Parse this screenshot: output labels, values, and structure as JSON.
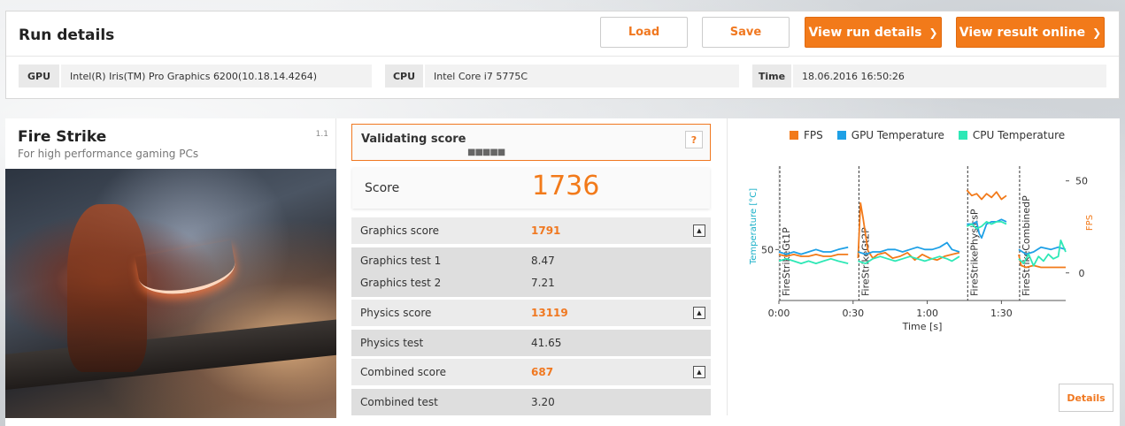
{
  "run": {
    "title": "Run details",
    "buttons": {
      "load": "Load",
      "save": "Save",
      "view_run_details": "View run details",
      "view_result_online": "View result online"
    },
    "info": {
      "gpu_label": "GPU",
      "gpu_value": "Intel(R) Iris(TM) Pro Graphics 6200(10.18.14.4264)",
      "cpu_label": "CPU",
      "cpu_value": "Intel Core i7 5775C",
      "time_label": "Time",
      "time_value": "18.06.2016 16:50:26"
    }
  },
  "benchmark": {
    "title": "Fire Strike",
    "subtitle": "For high performance gaming PCs",
    "version": "1.1"
  },
  "validation": {
    "label": "Validating score",
    "progress": "■■■■■",
    "help": "?"
  },
  "score": {
    "label": "Score",
    "value": "1736"
  },
  "results": {
    "graphics": {
      "label": "Graphics score",
      "value": "1791",
      "tests": [
        {
          "label": "Graphics test 1",
          "value": "8.47"
        },
        {
          "label": "Graphics test 2",
          "value": "7.21"
        }
      ]
    },
    "physics": {
      "label": "Physics score",
      "value": "13119",
      "tests": [
        {
          "label": "Physics test",
          "value": "41.65"
        }
      ]
    },
    "combined": {
      "label": "Combined score",
      "value": "687",
      "tests": [
        {
          "label": "Combined test",
          "value": "3.20"
        }
      ]
    }
  },
  "chart": {
    "details_button": "Details"
  },
  "chart_data": {
    "type": "line",
    "legend": [
      {
        "name": "FPS",
        "color": "#f27a1a"
      },
      {
        "name": "GPU Temperature",
        "color": "#1ea0e6"
      },
      {
        "name": "CPU Temperature",
        "color": "#2ee8b6"
      }
    ],
    "xlabel": "Time [s]",
    "ylabel_left": "Temperature [°C]",
    "ylabel_right": "FPS",
    "x_ticks": [
      "0:00",
      "0:30",
      "1:00",
      "1:30"
    ],
    "x_tick_values": [
      0,
      30,
      60,
      90
    ],
    "xlim": [
      0,
      116
    ],
    "y_left_ticks": [
      "50"
    ],
    "y_left_tick_values": [
      50
    ],
    "y_left_lim": [
      28,
      86
    ],
    "y_right_ticks": [
      "50",
      "0"
    ],
    "y_right_tick_values": [
      50,
      0
    ],
    "y_right_lim": [
      -15,
      58
    ],
    "sections": [
      {
        "name": "FireStrikeGt1P",
        "x": 0
      },
      {
        "name": "FireStrikeGt2P",
        "x": 32
      },
      {
        "name": "FireStrikePhysicsP",
        "x": 76
      },
      {
        "name": "FireStrikeCombinedP",
        "x": 97
      }
    ],
    "series": [
      {
        "name": "FPS",
        "axis": "right",
        "segments": [
          [
            [
              0,
              10
            ],
            [
              3,
              9
            ],
            [
              6,
              10
            ],
            [
              9,
              9
            ],
            [
              12,
              9
            ],
            [
              15,
              10
            ],
            [
              18,
              9
            ],
            [
              21,
              9
            ],
            [
              24,
              10
            ],
            [
              28,
              10
            ]
          ],
          [
            [
              32,
              8
            ],
            [
              33,
              38
            ],
            [
              34,
              30
            ],
            [
              36,
              12
            ],
            [
              38,
              8
            ],
            [
              40,
              10
            ],
            [
              43,
              11
            ],
            [
              46,
              8
            ],
            [
              49,
              9
            ],
            [
              52,
              11
            ],
            [
              55,
              7
            ],
            [
              58,
              10
            ],
            [
              61,
              8
            ],
            [
              64,
              7
            ],
            [
              67,
              9
            ],
            [
              70,
              10
            ],
            [
              73,
              11
            ]
          ],
          [
            [
              76,
              45
            ],
            [
              78,
              42
            ],
            [
              80,
              43
            ],
            [
              82,
              40
            ],
            [
              84,
              43
            ],
            [
              86,
              41
            ],
            [
              88,
              44
            ],
            [
              90,
              40
            ],
            [
              92,
              42
            ]
          ],
          [
            [
              97,
              10
            ],
            [
              98,
              4
            ],
            [
              100,
              3
            ],
            [
              103,
              4
            ],
            [
              106,
              3
            ],
            [
              110,
              3
            ],
            [
              113,
              3
            ],
            [
              116,
              3
            ]
          ]
        ]
      },
      {
        "name": "GPU Temperature",
        "axis": "left",
        "segments": [
          [
            [
              0,
              49
            ],
            [
              3,
              48
            ],
            [
              6,
              49
            ],
            [
              9,
              48
            ],
            [
              12,
              49
            ],
            [
              15,
              50
            ],
            [
              18,
              49
            ],
            [
              21,
              49
            ],
            [
              24,
              50
            ],
            [
              28,
              51
            ]
          ],
          [
            [
              32,
              49
            ],
            [
              35,
              48
            ],
            [
              38,
              49
            ],
            [
              41,
              49
            ],
            [
              44,
              50
            ],
            [
              47,
              50
            ],
            [
              50,
              49
            ],
            [
              53,
              50
            ],
            [
              56,
              51
            ],
            [
              59,
              50
            ],
            [
              62,
              50
            ],
            [
              65,
              51
            ],
            [
              68,
              53
            ],
            [
              70,
              50
            ],
            [
              73,
              49
            ]
          ],
          [
            [
              76,
              61
            ],
            [
              78,
              61
            ],
            [
              80,
              62
            ],
            [
              81,
              57
            ],
            [
              82,
              55
            ],
            [
              84,
              61
            ],
            [
              86,
              62
            ],
            [
              88,
              62
            ],
            [
              90,
              63
            ],
            [
              92,
              62
            ]
          ],
          [
            [
              97,
              50
            ],
            [
              100,
              48
            ],
            [
              103,
              49
            ],
            [
              106,
              51
            ],
            [
              110,
              50
            ],
            [
              113,
              51
            ],
            [
              116,
              50
            ]
          ]
        ]
      },
      {
        "name": "CPU Temperature",
        "axis": "left",
        "segments": [
          [
            [
              0,
              45
            ],
            [
              3,
              46
            ],
            [
              6,
              45
            ],
            [
              9,
              44
            ],
            [
              12,
              45
            ],
            [
              15,
              44
            ],
            [
              18,
              45
            ],
            [
              21,
              46
            ],
            [
              24,
              45
            ],
            [
              28,
              44
            ]
          ],
          [
            [
              32,
              45
            ],
            [
              35,
              44
            ],
            [
              38,
              46
            ],
            [
              41,
              47
            ],
            [
              44,
              46
            ],
            [
              47,
              45
            ],
            [
              50,
              46
            ],
            [
              53,
              47
            ],
            [
              56,
              46
            ],
            [
              59,
              45
            ],
            [
              62,
              46
            ],
            [
              65,
              47
            ],
            [
              68,
              46
            ],
            [
              70,
              45
            ],
            [
              73,
              47
            ]
          ],
          [
            [
              76,
              60
            ],
            [
              78,
              61
            ],
            [
              80,
              59
            ],
            [
              82,
              60
            ],
            [
              84,
              62
            ],
            [
              86,
              61
            ],
            [
              88,
              62
            ],
            [
              90,
              62
            ],
            [
              92,
              61
            ]
          ],
          [
            [
              97,
              46
            ],
            [
              99,
              44
            ],
            [
              101,
              48
            ],
            [
              103,
              43
            ],
            [
              105,
              47
            ],
            [
              107,
              45
            ],
            [
              109,
              48
            ],
            [
              111,
              46
            ],
            [
              113,
              47
            ],
            [
              114,
              54
            ],
            [
              116,
              49
            ]
          ]
        ]
      }
    ]
  }
}
